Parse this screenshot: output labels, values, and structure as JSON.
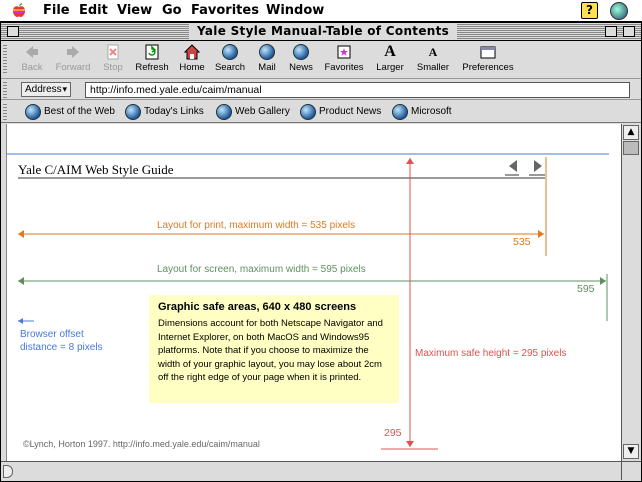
{
  "menubar": {
    "items": [
      "File",
      "Edit",
      "View",
      "Go",
      "Favorites",
      "Window"
    ],
    "help_label": "?"
  },
  "window": {
    "title": "Yale Style Manual-Table of Contents"
  },
  "toolbar": {
    "buttons": [
      {
        "label": "Back",
        "icon": "back-arrow-icon",
        "enabled": false
      },
      {
        "label": "Forward",
        "icon": "forward-arrow-icon",
        "enabled": false
      },
      {
        "label": "Stop",
        "icon": "stop-icon",
        "enabled": false
      },
      {
        "label": "Refresh",
        "icon": "refresh-icon",
        "enabled": true
      },
      {
        "label": "Home",
        "icon": "home-icon",
        "enabled": true
      },
      {
        "label": "Search",
        "icon": "search-globe-icon",
        "enabled": true
      },
      {
        "label": "Mail",
        "icon": "mail-icon",
        "enabled": true
      },
      {
        "label": "News",
        "icon": "news-icon",
        "enabled": true
      },
      {
        "label": "Favorites",
        "icon": "favorites-icon",
        "enabled": true
      },
      {
        "label": "Larger",
        "icon": "larger-text-icon",
        "enabled": true
      },
      {
        "label": "Smaller",
        "icon": "smaller-text-icon",
        "enabled": true
      },
      {
        "label": "Preferences",
        "icon": "preferences-icon",
        "enabled": true
      }
    ]
  },
  "address": {
    "label": "Address",
    "value": "http://info.med.yale.edu/caim/manual"
  },
  "links": {
    "items": [
      "Best of the Web",
      "Today's Links",
      "Web Gallery",
      "Product News",
      "Microsoft"
    ]
  },
  "page": {
    "guide_title": "Yale C/AIM Web Style Guide",
    "print_label": "Layout for print, maximum width = 535 pixels",
    "print_value": "535",
    "screen_label": "Layout for screen, maximum width = 595 pixels",
    "screen_value": "595",
    "offset_label_line1": "Browser offset",
    "offset_label_line2": "distance = 8 pixels",
    "safe_title": "Graphic safe areas, 640 x 480 screens",
    "safe_body": "Dimensions account for both Netscape Navigator and Internet Explorer, on both MacOS and Windows95 platforms. Note that if you choose to maximize the width of your graphic layout, you may lose about 2cm off the right edge of your page when it is printed.",
    "height_label": "Maximum safe height = 295 pixels",
    "height_value": "295",
    "footer": "©Lynch, Horton 1997.   http://info.med.yale.edu/caim/manual"
  },
  "colors": {
    "print": "#e07a1f",
    "screen": "#5f8f5f",
    "offset": "#4a78d4",
    "height": "#e05050",
    "safe_box": "#ffffc4"
  }
}
